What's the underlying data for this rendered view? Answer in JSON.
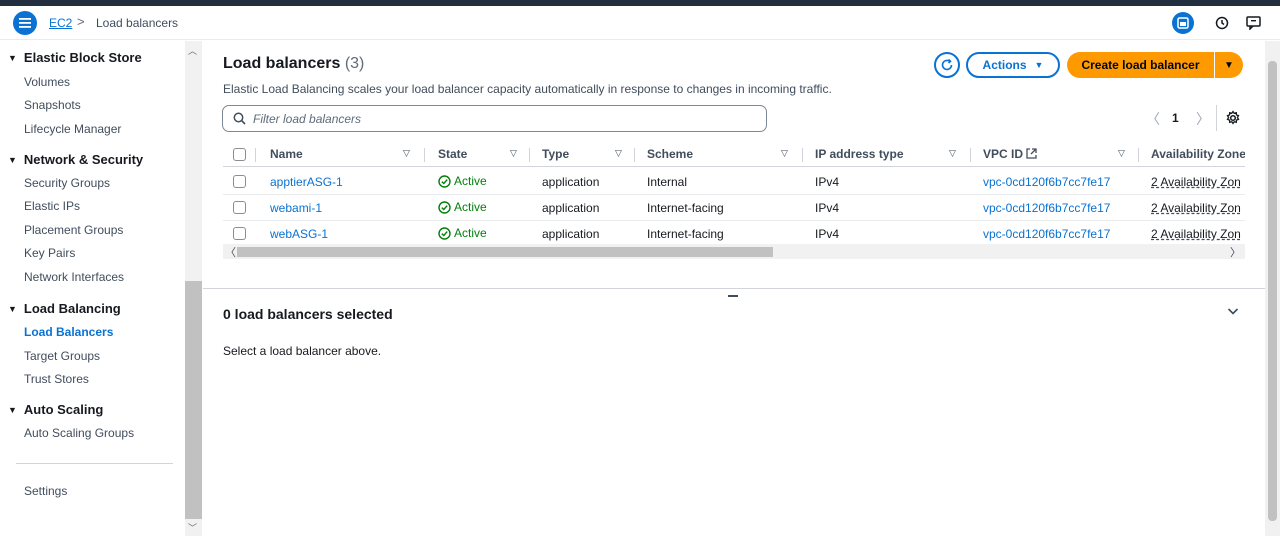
{
  "breadcrumb": {
    "root": "EC2",
    "separator": ">",
    "current": "Load balancers"
  },
  "sidebar": {
    "sections": [
      {
        "title": "Elastic Block Store",
        "items": [
          "Volumes",
          "Snapshots",
          "Lifecycle Manager"
        ]
      },
      {
        "title": "Network & Security",
        "items": [
          "Security Groups",
          "Elastic IPs",
          "Placement Groups",
          "Key Pairs",
          "Network Interfaces"
        ]
      },
      {
        "title": "Load Balancing",
        "items": [
          "Load Balancers",
          "Target Groups",
          "Trust Stores"
        ]
      },
      {
        "title": "Auto Scaling",
        "items": [
          "Auto Scaling Groups"
        ]
      }
    ],
    "active_item": "Load Balancers",
    "settings": "Settings"
  },
  "panel": {
    "title": "Load balancers",
    "count": "(3)",
    "description": "Elastic Load Balancing scales your load balancer capacity automatically in response to changes in incoming traffic.",
    "actions_label": "Actions",
    "create_label": "Create load balancer",
    "filter_placeholder": "Filter load balancers",
    "page": "1"
  },
  "table": {
    "columns": [
      "Name",
      "State",
      "Type",
      "Scheme",
      "IP address type",
      "VPC ID",
      "Availability Zone"
    ],
    "rows": [
      {
        "name": "apptierASG-1",
        "state": "Active",
        "type": "application",
        "scheme": "Internal",
        "ip": "IPv4",
        "vpc": "vpc-0cd120f6b7cc7fe17",
        "az": "2 Availability Zon"
      },
      {
        "name": "webami-1",
        "state": "Active",
        "type": "application",
        "scheme": "Internet-facing",
        "ip": "IPv4",
        "vpc": "vpc-0cd120f6b7cc7fe17",
        "az": "2 Availability Zon"
      },
      {
        "name": "webASG-1",
        "state": "Active",
        "type": "application",
        "scheme": "Internet-facing",
        "ip": "IPv4",
        "vpc": "vpc-0cd120f6b7cc7fe17",
        "az": "2 Availability Zon"
      }
    ]
  },
  "details": {
    "title": "0 load balancers selected",
    "text": "Select a load balancer above."
  },
  "colors": {
    "link": "#0972d3",
    "primary_button": "#ff9900",
    "active_status": "#037f0c"
  }
}
